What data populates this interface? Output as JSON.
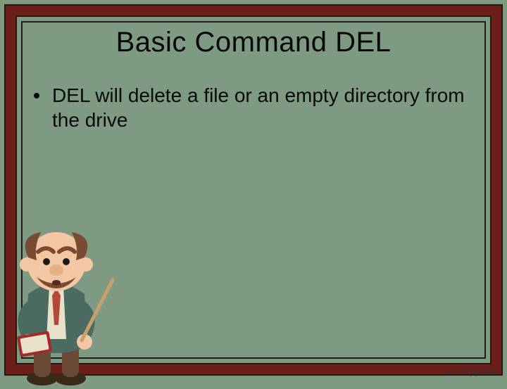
{
  "slide": {
    "title": "Basic Command DEL",
    "bullets": [
      "DEL will delete a file or an empty directory from the drive"
    ]
  },
  "watermark": "www.fppt.info",
  "colors": {
    "board": "#7e9a83",
    "frame": "#6a1f1a",
    "text": "#080808"
  },
  "illustration": "professor-with-book-and-pointer"
}
